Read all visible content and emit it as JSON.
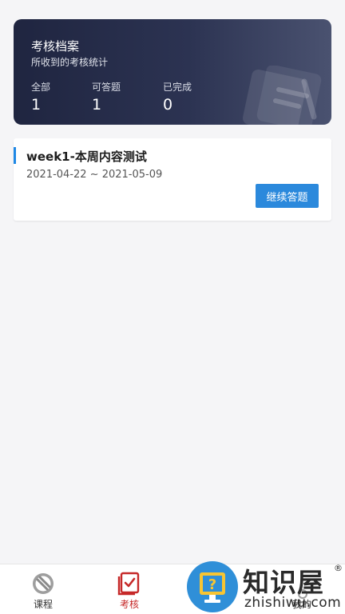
{
  "summary": {
    "title": "考核档案",
    "subtitle": "所收到的考核统计",
    "stats": [
      {
        "label": "全部",
        "value": "1"
      },
      {
        "label": "可答题",
        "value": "1"
      },
      {
        "label": "已完成",
        "value": "0"
      }
    ]
  },
  "exams": [
    {
      "title": "week1-本周内容测试",
      "dates": "2021-04-22 ~ 2021-05-09",
      "button_label": "继续答题"
    }
  ],
  "nav": {
    "items": [
      {
        "label": "课程",
        "icon": "course-icon",
        "active": false
      },
      {
        "label": "考核",
        "icon": "exam-check-icon",
        "active": true
      },
      {
        "label": "",
        "icon": "question-icon",
        "active": false
      },
      {
        "label": "我的",
        "icon": "profile-icon",
        "active": false
      }
    ]
  },
  "watermark": {
    "text_cn": "知识屋",
    "text_en": "zhishiwu.com",
    "registered": "®"
  },
  "colors": {
    "accent": "#2b89dc",
    "active_tab": "#c62828",
    "card_dark": "#2c3352"
  }
}
